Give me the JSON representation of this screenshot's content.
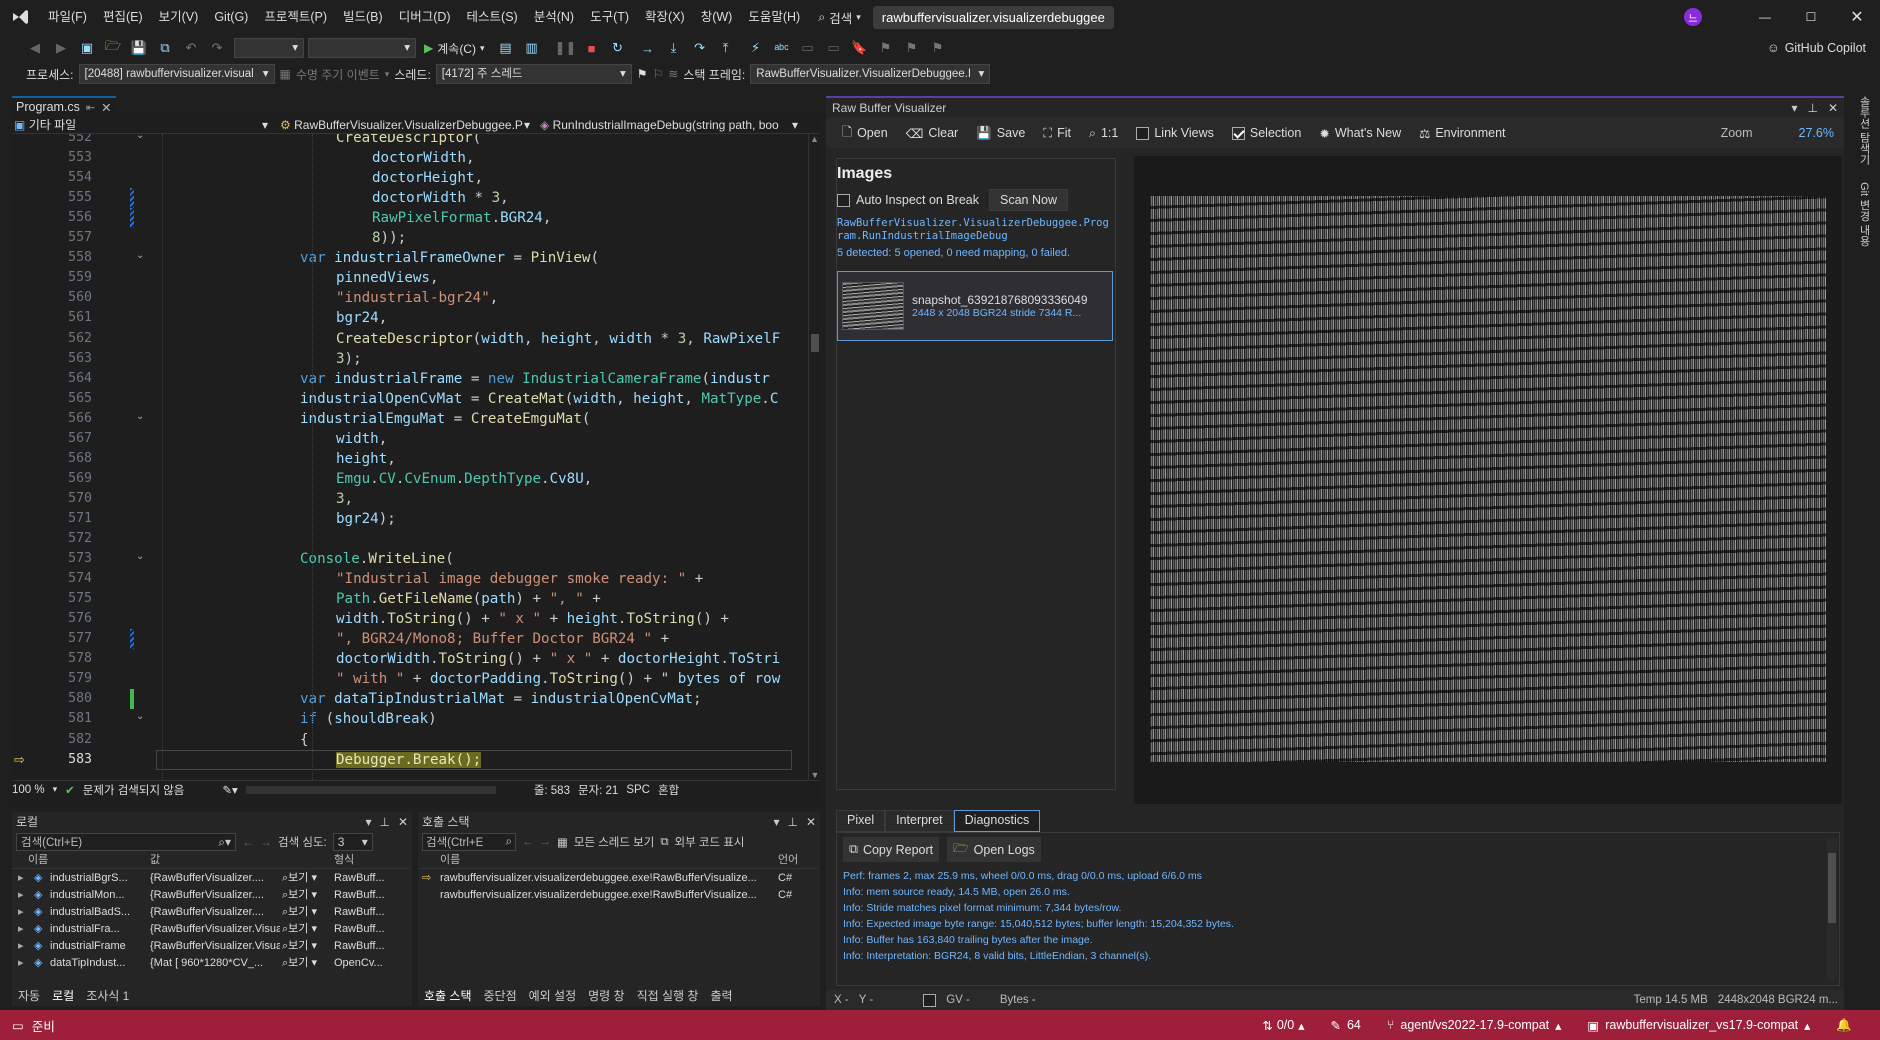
{
  "menu": [
    "파일(F)",
    "편집(E)",
    "보기(V)",
    "Git(G)",
    "프로젝트(P)",
    "빌드(B)",
    "디버그(D)",
    "테스트(S)",
    "분석(N)",
    "도구(T)",
    "확장(X)",
    "창(W)",
    "도움말(H)"
  ],
  "search_label": "검색",
  "window_title": "rawbuffervisualizer.visualizerdebuggee",
  "user_initial": "느",
  "toolbar": {
    "continue_label": "계속(C)",
    "copilot": "GitHub Copilot"
  },
  "debugbar": {
    "process_label": "프로세스:",
    "process_value": "[20488] rawbuffervisualizer.visual",
    "lifecycle_label": "수명 주기 이벤트",
    "thread_label": "스레드:",
    "thread_value": "[4172] 주 스레드",
    "stack_label": "스택 프레임:",
    "stack_value": "RawBufferVisualizer.VisualizerDebuggee.I"
  },
  "editor": {
    "tab_name": "Program.cs",
    "nav_misc": "기타 파일",
    "nav_class": "RawBufferVisualizer.VisualizerDebuggee.P",
    "nav_member": "RunIndustrialImageDebug(string path, boo",
    "zoom": "100 %",
    "issues": "문제가 검색되지 않음",
    "line_label": "줄: 583",
    "col_label": "문자: 21",
    "spc": "SPC",
    "crlf": "혼합",
    "lines": [
      {
        "n": "552",
        "indent": 1,
        "text": "CreateDescriptor("
      },
      {
        "n": "553",
        "indent": 2,
        "text": "doctorWidth,"
      },
      {
        "n": "554",
        "indent": 2,
        "text": "doctorHeight,"
      },
      {
        "n": "555",
        "indent": 2,
        "text": "doctorWidth * 3,"
      },
      {
        "n": "556",
        "indent": 2,
        "text": "RawPixelFormat.BGR24,"
      },
      {
        "n": "557",
        "indent": 2,
        "text": "8));"
      },
      {
        "n": "558",
        "indent": 0,
        "text": "var industrialFrameOwner = PinView("
      },
      {
        "n": "559",
        "indent": 1,
        "text": "pinnedViews,"
      },
      {
        "n": "560",
        "indent": 1,
        "text": "\"industrial-bgr24\","
      },
      {
        "n": "561",
        "indent": 1,
        "text": "bgr24,"
      },
      {
        "n": "562",
        "indent": 1,
        "text": "CreateDescriptor(width, height, width * 3, RawPixelF"
      },
      {
        "n": "563",
        "indent": 1,
        "text": "3);"
      },
      {
        "n": "564",
        "indent": 0,
        "text": "var industrialFrame = new IndustrialCameraFrame(industr"
      },
      {
        "n": "565",
        "indent": 0,
        "text": "industrialOpenCvMat = CreateMat(width, height, MatType.C"
      },
      {
        "n": "566",
        "indent": 0,
        "text": "industrialEmguMat = CreateEmguMat("
      },
      {
        "n": "567",
        "indent": 1,
        "text": "width,"
      },
      {
        "n": "568",
        "indent": 1,
        "text": "height,"
      },
      {
        "n": "569",
        "indent": 1,
        "text": "Emgu.CV.CvEnum.DepthType.Cv8U,"
      },
      {
        "n": "570",
        "indent": 1,
        "text": "3,"
      },
      {
        "n": "571",
        "indent": 1,
        "text": "bgr24);"
      },
      {
        "n": "572",
        "indent": 0,
        "text": ""
      },
      {
        "n": "573",
        "indent": 0,
        "text": "Console.WriteLine("
      },
      {
        "n": "574",
        "indent": 1,
        "text": "\"Industrial image debugger smoke ready: \" +"
      },
      {
        "n": "575",
        "indent": 1,
        "text": "Path.GetFileName(path) + \", \" +"
      },
      {
        "n": "576",
        "indent": 1,
        "text": "width.ToString() + \" x \" + height.ToString() +"
      },
      {
        "n": "577",
        "indent": 1,
        "text": "\", BGR24/Mono8; Buffer Doctor BGR24 \" +"
      },
      {
        "n": "578",
        "indent": 1,
        "text": "doctorWidth.ToString() + \" x \" + doctorHeight.ToStri"
      },
      {
        "n": "579",
        "indent": 1,
        "text": "\" with \" + doctorPadding.ToString() + \" bytes of row"
      },
      {
        "n": "580",
        "indent": 0,
        "text": "var dataTipIndustrialMat = industrialOpenCvMat;"
      },
      {
        "n": "581",
        "indent": 0,
        "text": "if (shouldBreak)"
      },
      {
        "n": "582",
        "indent": 0,
        "text": "{"
      },
      {
        "n": "583",
        "indent": 1,
        "text": "Debugger.Break();"
      }
    ]
  },
  "visualizer": {
    "title": "Raw Buffer Visualizer",
    "toolbar": {
      "open": "Open",
      "clear": "Clear",
      "save": "Save",
      "fit": "Fit",
      "one_to_one": "1:1",
      "link_views": "Link Views",
      "selection": "Selection",
      "whats_new": "What's New",
      "environment": "Environment",
      "zoom_label": "Zoom",
      "zoom_value": "27.6%"
    },
    "images_heading": "Images",
    "auto_inspect": "Auto Inspect on Break",
    "scan_now": "Scan Now",
    "source_path": "RawBufferVisualizer.VisualizerDebuggee.Program.RunIndustrialImageDebug",
    "detect_summary": "5 detected: 5 opened, 0 need mapping, 0 failed.",
    "snapshot_name": "snapshot_639218768093336049",
    "snapshot_meta": "2448 x 2048   BGR24   stride 7344   R...",
    "tabs": [
      "Pixel",
      "Interpret",
      "Diagnostics"
    ],
    "copy_report": "Copy Report",
    "open_logs": "Open Logs",
    "log_lines": [
      "Perf: frames 2, max 25.9 ms, wheel 0/0.0 ms, drag 0/0.0 ms, upload 6/6.0 ms",
      "Info: mem source ready, 14.5 MB, open 26.0 ms.",
      "Info: Stride matches pixel format minimum: 7,344 bytes/row.",
      "Info: Expected image byte range: 15,040,512 bytes; buffer length: 15,204,352 bytes.",
      "Info: Buffer has 163,840 trailing bytes after the image.",
      "Info: Interpretation: BGR24, 8 valid bits, LittleEndian, 3 channel(s)."
    ],
    "status_x": "X -",
    "status_y": "Y -",
    "status_gv": "GV -",
    "status_bytes": "Bytes -",
    "status_temp": "Temp 14.5 MB",
    "status_info": "2448x2048 BGR24 m..."
  },
  "side_rail": [
    "솔루션 탐색기",
    "Git 변경 내용"
  ],
  "locals": {
    "title": "로컬",
    "search_placeholder": "검색(Ctrl+E)",
    "depth_label": "검색 심도:",
    "depth_value": "3",
    "col_name": "이름",
    "col_value": "값",
    "col_type": "형식",
    "view_label": "보기",
    "rows": [
      {
        "name": "industrialBgrS...",
        "value": "{RawBufferVisualizer....",
        "type": "RawBuff..."
      },
      {
        "name": "industrialMon...",
        "value": "{RawBufferVisualizer....",
        "type": "RawBuff..."
      },
      {
        "name": "industrialBadS...",
        "value": "{RawBufferVisualizer....",
        "type": "RawBuff..."
      },
      {
        "name": "industrialFra...",
        "value": "{RawBufferVisualizer.Visualiz...",
        "type": "RawBuff..."
      },
      {
        "name": "industrialFrame",
        "value": "{RawBufferVisualizer.VisualizerD...",
        "type": "RawBuff..."
      },
      {
        "name": "dataTipIndust...",
        "value": "{Mat [ 960*1280*CV_...",
        "type": "OpenCv..."
      }
    ],
    "bottom_tabs": [
      "자동",
      "로컬",
      "조사식 1"
    ]
  },
  "callstack": {
    "title": "호출 스택",
    "search_placeholder": "검색(Ctrl+E",
    "all_threads": "모든 스레드 보기",
    "external_code": "외부 코드 표시",
    "col_name": "이름",
    "col_lang": "언어",
    "rows": [
      {
        "name": "rawbuffervisualizer.visualizerdebuggee.exe!RawBufferVisualize...",
        "lang": "C#"
      },
      {
        "name": "rawbuffervisualizer.visualizerdebuggee.exe!RawBufferVisualize...",
        "lang": "C#"
      }
    ],
    "bottom_tabs": [
      "호출 스택",
      "중단점",
      "예외 설정",
      "명령 창",
      "직접 실행 창",
      "출력"
    ]
  },
  "statusbar": {
    "ready": "준비",
    "errors": "0/0",
    "pencil": "64",
    "branch": "agent/vs2022-17.9-compat",
    "repo": "rawbuffervisualizer_vs17.9-compat"
  },
  "colors": {
    "accent": "#9e1f3a",
    "link": "#6fb7ff",
    "selection_border": "#5b9bd5"
  }
}
